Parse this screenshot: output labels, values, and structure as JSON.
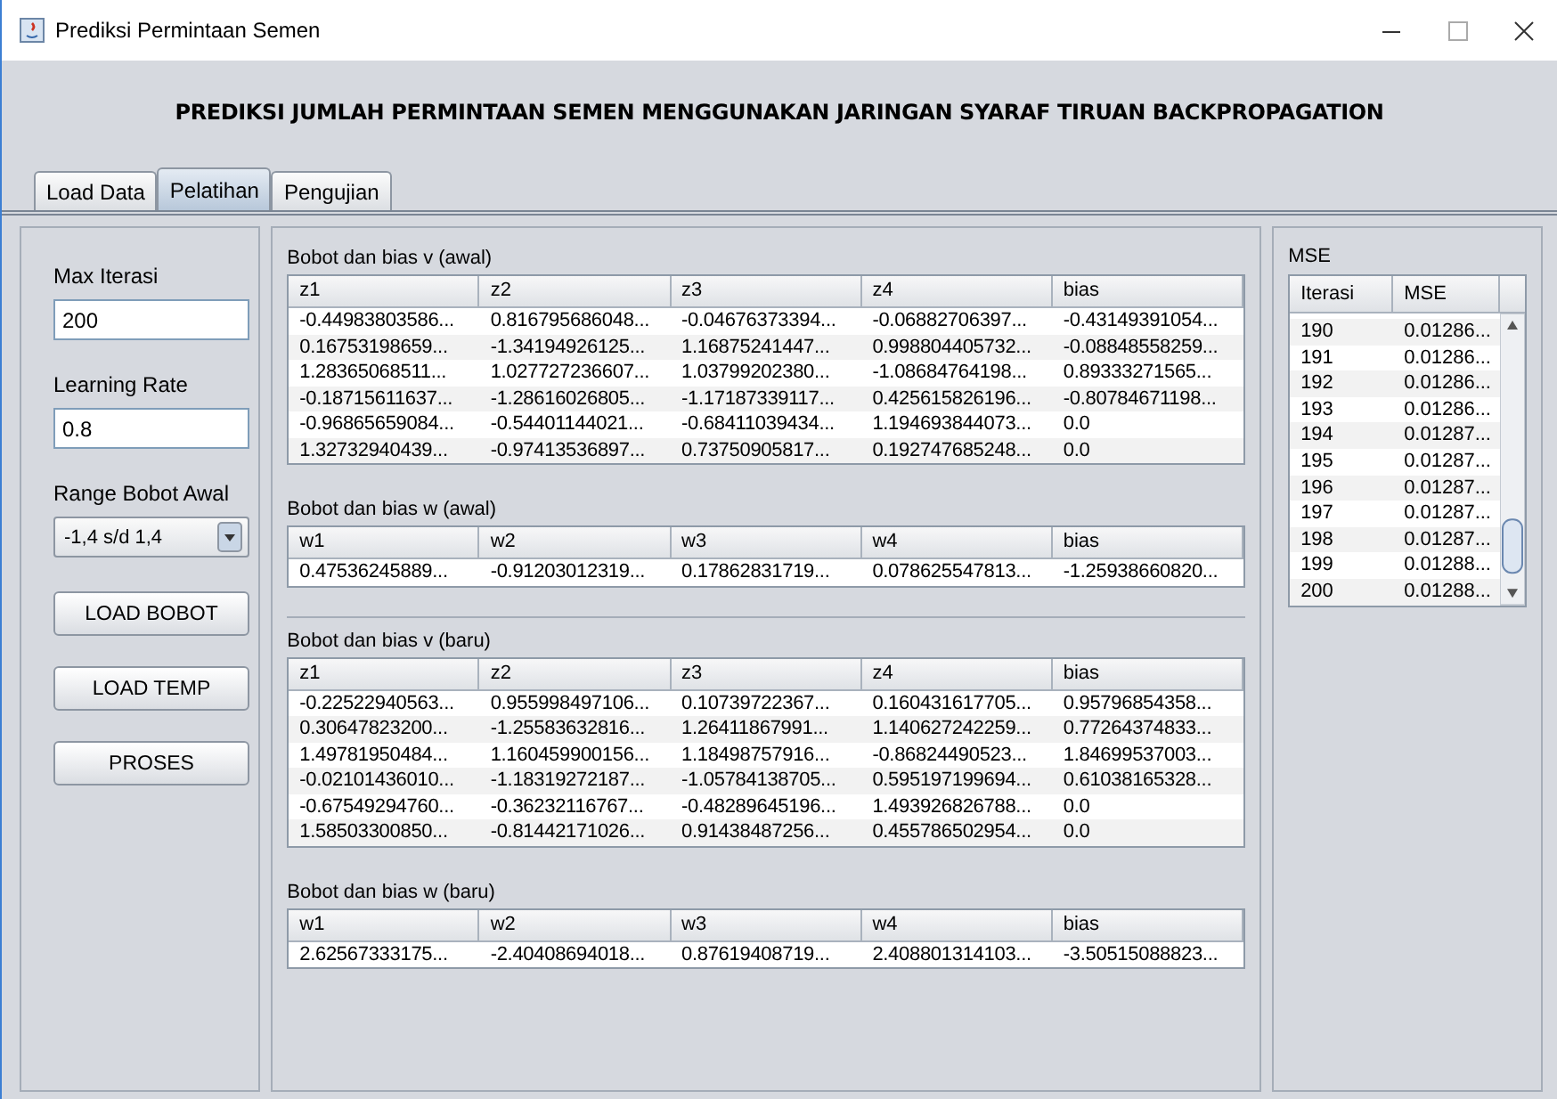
{
  "window": {
    "title": "Prediksi Permintaan Semen"
  },
  "heading": "PREDIKSI JUMLAH PERMINTAAN SEMEN MENGGUNAKAN JARINGAN SYARAF TIRUAN BACKPROPAGATION",
  "tabs": [
    {
      "label": "Load Data",
      "selected": false
    },
    {
      "label": "Pelatihan",
      "selected": true
    },
    {
      "label": "Pengujian",
      "selected": false
    }
  ],
  "parameters": [
    {
      "kind": "field",
      "label": "Max Iterasi",
      "value": "200"
    },
    {
      "kind": "field",
      "label": "Learning Rate",
      "value": "0.8"
    },
    {
      "kind": "combo",
      "label": "Range Bobot Awal",
      "value": "-1,4 s/d 1,4"
    }
  ],
  "buttons": [
    "LOAD BOBOT",
    "LOAD TEMP",
    "PROSES"
  ],
  "table_groups": [
    [
      {
        "title": "Bobot dan bias v (awal)",
        "columns": [
          "z1",
          "z2",
          "z3",
          "z4",
          "bias"
        ],
        "rows": [
          [
            "-0.44983803586...",
            "0.816795686048...",
            "-0.04676373394...",
            "-0.06882706397...",
            "-0.43149391054..."
          ],
          [
            "0.16753198659...",
            "-1.34194926125...",
            "1.16875241447...",
            "0.998804405732...",
            "-0.08848558259..."
          ],
          [
            "1.28365068511...",
            "1.027727236607...",
            "1.03799202380...",
            "-1.08684764198...",
            "0.89333271565..."
          ],
          [
            "-0.18715611637...",
            "-1.28616026805...",
            "-1.17187339117...",
            "0.425615826196...",
            "-0.80784671198..."
          ],
          [
            "-0.96865659084...",
            "-0.54401144021...",
            "-0.68411039434...",
            "1.194693844073...",
            "0.0"
          ],
          [
            "1.32732940439...",
            "-0.97413536897...",
            "0.73750905817...",
            "0.192747685248...",
            "0.0"
          ]
        ]
      },
      {
        "title": "Bobot dan bias w (awal)",
        "columns": [
          "w1",
          "w2",
          "w3",
          "w4",
          "bias"
        ],
        "rows": [
          [
            "0.47536245889...",
            "-0.91203012319...",
            "0.17862831719...",
            "0.078625547813...",
            "-1.25938660820..."
          ]
        ]
      }
    ],
    [
      {
        "title": "Bobot dan bias v (baru)",
        "columns": [
          "z1",
          "z2",
          "z3",
          "z4",
          "bias"
        ],
        "rows": [
          [
            "-0.22522940563...",
            "0.955998497106...",
            "0.10739722367...",
            "0.160431617705...",
            "0.95796854358..."
          ],
          [
            "0.30647823200...",
            "-1.25583632816...",
            "1.26411867991...",
            "1.140627242259...",
            "0.77264374833..."
          ],
          [
            "1.49781950484...",
            "1.160459900156...",
            "1.18498757916...",
            "-0.86824490523...",
            "1.84699537003..."
          ],
          [
            "-0.02101436010...",
            "-1.18319272187...",
            "-1.05784138705...",
            "0.595197199694...",
            "0.61038165328..."
          ],
          [
            "-0.67549294760...",
            "-0.36232116767...",
            "-0.48289645196...",
            "1.493926826788...",
            "0.0"
          ],
          [
            "1.58503300850...",
            "-0.81442171026...",
            "0.91438487256...",
            "0.455786502954...",
            "0.0"
          ]
        ]
      },
      {
        "title": "Bobot dan bias w (baru)",
        "columns": [
          "w1",
          "w2",
          "w3",
          "w4",
          "bias"
        ],
        "rows": [
          [
            "2.62567333175...",
            "-2.40408694018...",
            "0.87619408719...",
            "2.408801314103...",
            "-3.50515088823..."
          ]
        ]
      }
    ]
  ],
  "mse": {
    "title": "MSE",
    "columns": [
      "Iterasi",
      "MSE"
    ],
    "rows": [
      [
        "190",
        "0.01286..."
      ],
      [
        "191",
        "0.01286..."
      ],
      [
        "192",
        "0.01286..."
      ],
      [
        "193",
        "0.01286..."
      ],
      [
        "194",
        "0.01287..."
      ],
      [
        "195",
        "0.01287..."
      ],
      [
        "196",
        "0.01287..."
      ],
      [
        "197",
        "0.01287..."
      ],
      [
        "198",
        "0.01287..."
      ],
      [
        "199",
        "0.01288..."
      ],
      [
        "200",
        "0.01288..."
      ]
    ]
  }
}
